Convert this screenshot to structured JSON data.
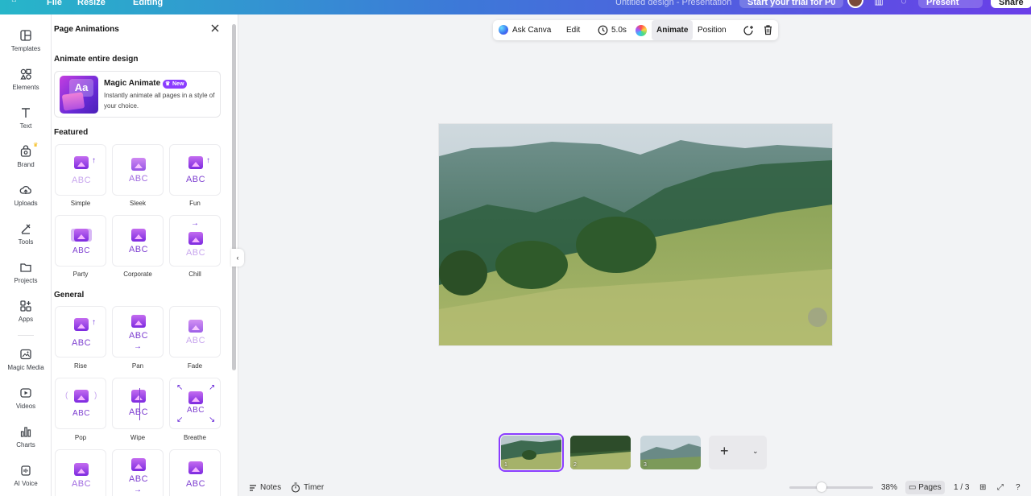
{
  "topbar": {
    "file_label": "File",
    "resize_label": "Resize",
    "editing_label": "Editing",
    "doc_title": "Untitled design - Presentation",
    "trial_label": "Start your trial for P0",
    "present_label": "Present",
    "share_label": "Share"
  },
  "rail": {
    "items": [
      {
        "label": "Templates",
        "icon": "templates-icon"
      },
      {
        "label": "Elements",
        "icon": "elements-icon"
      },
      {
        "label": "Text",
        "icon": "text-icon"
      },
      {
        "label": "Brand",
        "icon": "brand-icon"
      },
      {
        "label": "Uploads",
        "icon": "uploads-icon"
      },
      {
        "label": "Tools",
        "icon": "tools-icon"
      },
      {
        "label": "Projects",
        "icon": "projects-icon"
      },
      {
        "label": "Apps",
        "icon": "apps-icon"
      },
      {
        "label": "Magic Media",
        "icon": "magic-media-icon"
      },
      {
        "label": "Videos",
        "icon": "videos-icon"
      },
      {
        "label": "Charts",
        "icon": "charts-icon"
      },
      {
        "label": "AI Voice",
        "icon": "ai-voice-icon"
      }
    ]
  },
  "panel": {
    "title": "Page Animations",
    "animate_entire": "Animate entire design",
    "magic": {
      "name": "Magic Animate",
      "badge": "New",
      "description": "Instantly animate all pages in a style of your choice."
    },
    "featured_title": "Featured",
    "general_title": "General",
    "featured": [
      "Simple",
      "Sleek",
      "Fun",
      "Party",
      "Corporate",
      "Chill"
    ],
    "general": [
      "Rise",
      "Pan",
      "Fade",
      "Pop",
      "Wipe",
      "Breathe"
    ],
    "tile_text": "ABC"
  },
  "floatbar": {
    "ask_canva": "Ask Canva",
    "edit": "Edit",
    "duration": "5.0s",
    "animate": "Animate",
    "position": "Position"
  },
  "pages": {
    "thumbs": [
      "1",
      "2",
      "3"
    ],
    "selected": 1
  },
  "footer": {
    "notes": "Notes",
    "timer": "Timer",
    "zoom": "38%",
    "pages_label": "Pages",
    "page_count": "1 / 3"
  },
  "colors": {
    "accent": "#8b3dff",
    "topbar_start": "#27b6c9",
    "topbar_end": "#6a3ee8"
  }
}
